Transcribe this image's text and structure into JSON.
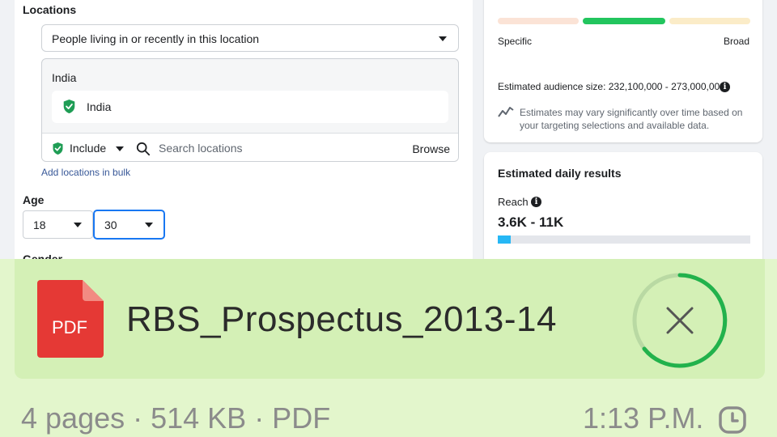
{
  "locations": {
    "heading": "Locations",
    "targeting_mode": "People living in or recently in this location",
    "country": "India",
    "selected_location": "India",
    "include_label": "Include",
    "search_placeholder": "Search locations",
    "browse_label": "Browse",
    "bulk_link": "Add locations in bulk"
  },
  "age": {
    "heading": "Age",
    "min": "18",
    "max": "30"
  },
  "gender": {
    "heading": "Gender"
  },
  "audience": {
    "specific_label": "Specific",
    "broad_label": "Broad",
    "size_text": "Estimated audience size: 232,100,000 - 273,000,000",
    "note": "Estimates may vary significantly over time based on your targeting selections and available data."
  },
  "daily_results": {
    "title": "Estimated daily results",
    "reach_label": "Reach",
    "reach_value": "3.6K - 11K",
    "reach_fill": 0.05
  },
  "attachment": {
    "file_type_badge": "PDF",
    "file_name": "RBS_Prospectus_2013-14",
    "meta": "4 pages · 514 KB · PDF",
    "time": "1:13 P.M."
  },
  "colors": {
    "include_green": "#1f9d55",
    "meter_green": "#22c55e",
    "reach_blue": "#26b7f5",
    "bubble_bg": "#d4f0b6",
    "pdf_red": "#e53935"
  },
  "icons": {
    "shield": "shield-check-icon",
    "search": "search-icon",
    "info": "info-icon",
    "trend": "trend-icon",
    "pdf": "pdf-file-icon",
    "cancel": "close-icon",
    "clock": "clock-icon"
  }
}
